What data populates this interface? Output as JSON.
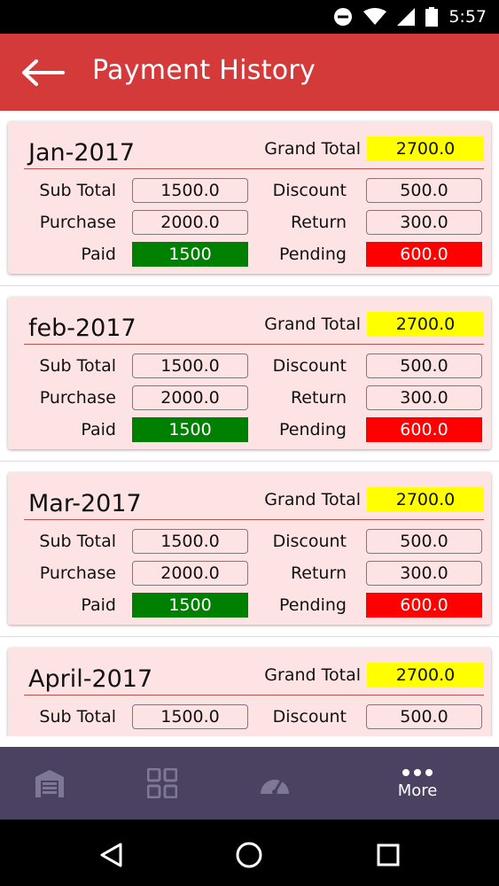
{
  "status_bar": {
    "time": "5:57"
  },
  "app_bar": {
    "title": "Payment History"
  },
  "labels": {
    "grand_total": "Grand Total",
    "sub_total": "Sub Total",
    "discount": "Discount",
    "purchase": "Purchase",
    "return": "Return",
    "paid": "Paid",
    "pending": "Pending"
  },
  "months": [
    {
      "name": "Jan-2017",
      "grand_total": "2700.0",
      "sub_total": "1500.0",
      "discount": "500.0",
      "purchase": "2000.0",
      "return": "300.0",
      "paid": "1500",
      "pending": "600.0"
    },
    {
      "name": "feb-2017",
      "grand_total": "2700.0",
      "sub_total": "1500.0",
      "discount": "500.0",
      "purchase": "2000.0",
      "return": "300.0",
      "paid": "1500",
      "pending": "600.0"
    },
    {
      "name": "Mar-2017",
      "grand_total": "2700.0",
      "sub_total": "1500.0",
      "discount": "500.0",
      "purchase": "2000.0",
      "return": "300.0",
      "paid": "1500",
      "pending": "600.0"
    },
    {
      "name": "April-2017",
      "grand_total": "2700.0",
      "sub_total": "1500.0",
      "discount": "500.0"
    }
  ],
  "bottom_nav": {
    "items": [
      {
        "icon": "store-icon"
      },
      {
        "icon": "grid-icon"
      },
      {
        "icon": "speedometer-icon"
      },
      {
        "icon": "more-dots-icon",
        "label": "More"
      }
    ]
  },
  "colors": {
    "app_bar": "#d53a3a",
    "card_bg": "#fde3e4",
    "grand_total_bg": "#ffff00",
    "paid_bg": "#008000",
    "pending_bg": "#ff0000",
    "bottom_nav_bg": "#4a4260",
    "nav_icon_inactive": "#7e7894"
  }
}
